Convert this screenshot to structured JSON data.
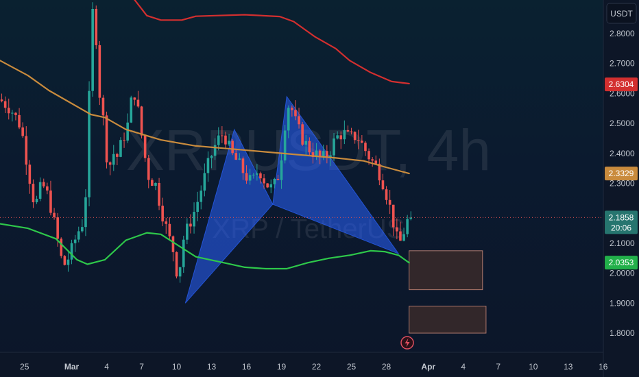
{
  "chart_data": {
    "type": "candlestick",
    "title": "",
    "watermark": "XRPUSDT, 4h",
    "watermark_sub": "XRP / TetherUS",
    "currency_label": "USDT",
    "ylim": [
      1.73,
      2.96
    ],
    "y_ticks": [
      "2.8000",
      "2.7000",
      "2.6000",
      "2.5000",
      "2.4000",
      "2.3000",
      "2.1000",
      "2.0000",
      "1.9000",
      "1.8000"
    ],
    "x_ticks": [
      {
        "label": "25",
        "bold": false
      },
      {
        "label": "Mar",
        "bold": true
      },
      {
        "label": "4",
        "bold": false
      },
      {
        "label": "7",
        "bold": false
      },
      {
        "label": "10",
        "bold": false
      },
      {
        "label": "13",
        "bold": false
      },
      {
        "label": "16",
        "bold": false
      },
      {
        "label": "19",
        "bold": false
      },
      {
        "label": "22",
        "bold": false
      },
      {
        "label": "25",
        "bold": false
      },
      {
        "label": "28",
        "bold": false
      },
      {
        "label": "Apr",
        "bold": true
      },
      {
        "label": "4",
        "bold": false
      },
      {
        "label": "7",
        "bold": false
      },
      {
        "label": "10",
        "bold": false
      },
      {
        "label": "13",
        "bold": false
      },
      {
        "label": "16",
        "bold": false
      }
    ],
    "price_path": [
      [
        0,
        2.58
      ],
      [
        3,
        2.55
      ],
      [
        6,
        2.49
      ],
      [
        8,
        2.35
      ],
      [
        10,
        2.22
      ],
      [
        12,
        2.3
      ],
      [
        14,
        2.25
      ],
      [
        16,
        2.14
      ],
      [
        18,
        2.02
      ],
      [
        20,
        2.06
      ],
      [
        22,
        2.13
      ],
      [
        24,
        2.18
      ],
      [
        25,
        2.35
      ],
      [
        26,
        2.82
      ],
      [
        27,
        2.92
      ],
      [
        28,
        2.65
      ],
      [
        29,
        2.55
      ],
      [
        30,
        2.48
      ],
      [
        31,
        2.31
      ],
      [
        32,
        2.42
      ],
      [
        33,
        2.38
      ],
      [
        34,
        2.4
      ],
      [
        35,
        2.45
      ],
      [
        36,
        2.47
      ],
      [
        37,
        2.52
      ],
      [
        38,
        2.62
      ],
      [
        39,
        2.58
      ],
      [
        40,
        2.5
      ],
      [
        41,
        2.42
      ],
      [
        42,
        2.35
      ],
      [
        43,
        2.3
      ],
      [
        44,
        2.32
      ],
      [
        46,
        2.22
      ],
      [
        48,
        2.13
      ],
      [
        50,
        2.06
      ],
      [
        51,
        1.96
      ],
      [
        52,
        2.1
      ],
      [
        54,
        2.16
      ],
      [
        56,
        2.22
      ],
      [
        58,
        2.3
      ],
      [
        60,
        2.38
      ],
      [
        62,
        2.44
      ],
      [
        64,
        2.47
      ],
      [
        66,
        2.4
      ],
      [
        68,
        2.37
      ],
      [
        70,
        2.33
      ],
      [
        72,
        2.3
      ],
      [
        74,
        2.35
      ],
      [
        76,
        2.3
      ],
      [
        78,
        2.28
      ],
      [
        80,
        2.34
      ],
      [
        81,
        2.45
      ],
      [
        82,
        2.55
      ],
      [
        83,
        2.57
      ],
      [
        84,
        2.52
      ],
      [
        86,
        2.46
      ],
      [
        88,
        2.42
      ],
      [
        90,
        2.4
      ],
      [
        92,
        2.38
      ],
      [
        94,
        2.4
      ],
      [
        96,
        2.45
      ],
      [
        98,
        2.47
      ],
      [
        100,
        2.45
      ],
      [
        102,
        2.46
      ],
      [
        104,
        2.42
      ],
      [
        106,
        2.38
      ],
      [
        108,
        2.35
      ],
      [
        110,
        2.29
      ],
      [
        111,
        2.24
      ],
      [
        112,
        2.2
      ],
      [
        113,
        2.14
      ],
      [
        114,
        2.09
      ],
      [
        115,
        2.12
      ],
      [
        116,
        2.16
      ],
      [
        117,
        2.19
      ]
    ],
    "series": [
      {
        "color": "#d32f2f",
        "values": [
          [
            36,
            2.95
          ],
          [
            42,
            2.86
          ],
          [
            46,
            2.845
          ],
          [
            52,
            2.845
          ],
          [
            56,
            2.858
          ],
          [
            70,
            2.863
          ],
          [
            80,
            2.857
          ],
          [
            84,
            2.84
          ],
          [
            90,
            2.79
          ],
          [
            96,
            2.75
          ],
          [
            100,
            2.71
          ],
          [
            106,
            2.67
          ],
          [
            112,
            2.64
          ],
          [
            117,
            2.633
          ]
        ]
      },
      {
        "color": "#c98b3d",
        "values": [
          [
            0,
            2.71
          ],
          [
            8,
            2.66
          ],
          [
            14,
            2.61
          ],
          [
            20,
            2.57
          ],
          [
            26,
            2.53
          ],
          [
            30,
            2.52
          ],
          [
            36,
            2.48
          ],
          [
            46,
            2.445
          ],
          [
            56,
            2.425
          ],
          [
            66,
            2.415
          ],
          [
            76,
            2.405
          ],
          [
            86,
            2.395
          ],
          [
            96,
            2.385
          ],
          [
            104,
            2.375
          ],
          [
            110,
            2.355
          ],
          [
            117,
            2.333
          ]
        ]
      },
      {
        "color": "#2ec84a",
        "values": [
          [
            0,
            2.165
          ],
          [
            8,
            2.15
          ],
          [
            16,
            2.115
          ],
          [
            22,
            2.045
          ],
          [
            25,
            2.03
          ],
          [
            30,
            2.045
          ],
          [
            36,
            2.11
          ],
          [
            42,
            2.135
          ],
          [
            46,
            2.13
          ],
          [
            52,
            2.085
          ],
          [
            56,
            2.055
          ],
          [
            62,
            2.04
          ],
          [
            70,
            2.02
          ],
          [
            76,
            2.015
          ],
          [
            82,
            2.015
          ],
          [
            88,
            2.035
          ],
          [
            94,
            2.05
          ],
          [
            100,
            2.06
          ],
          [
            106,
            2.075
          ],
          [
            110,
            2.072
          ],
          [
            114,
            2.06
          ],
          [
            117,
            2.035
          ]
        ]
      }
    ],
    "pattern": {
      "color": "#2962ff",
      "points": [
        [
          53,
          1.9
        ],
        [
          67,
          2.48
        ],
        [
          78,
          2.23
        ],
        [
          82,
          2.59
        ],
        [
          114,
          2.065
        ]
      ],
      "triangles": [
        [
          0,
          1,
          2
        ],
        [
          2,
          3,
          4
        ]
      ]
    },
    "boxes": [
      {
        "from": 117,
        "to": 138,
        "top": 2.075,
        "bottom": 1.945
      },
      {
        "from": 117,
        "to": 139,
        "top": 1.89,
        "bottom": 1.8
      }
    ],
    "current_price_line": 2.1858,
    "badges": [
      {
        "value": "2.6304",
        "sub": "",
        "color": "#d32f2f"
      },
      {
        "value": "2.3329",
        "sub": "",
        "color": "#c98b3d"
      },
      {
        "value": "2.1858",
        "sub": "20:06",
        "color": "#26756f"
      },
      {
        "value": "2.0353",
        "sub": "",
        "color": "#22b04a"
      }
    ],
    "grid": false,
    "legend": "none"
  }
}
